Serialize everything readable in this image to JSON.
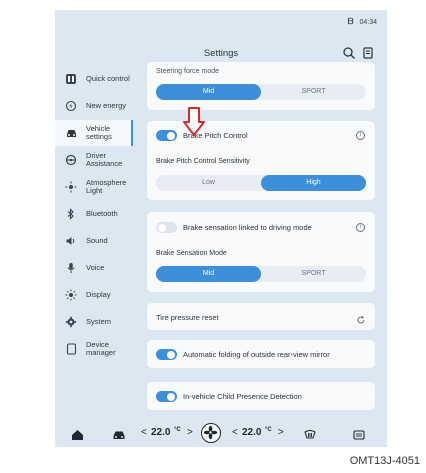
{
  "status": {
    "clock": "04:34",
    "icon": "b-icon"
  },
  "header": {
    "title": "Settings",
    "search_icon": "search-icon",
    "edit_icon": "edit-icon"
  },
  "sidebar": {
    "items": [
      {
        "label": "Quick control",
        "icon": "quick-control-icon"
      },
      {
        "label": "New energy",
        "icon": "new-energy-icon"
      },
      {
        "label": "Vehicle settings",
        "icon": "car-icon",
        "active": true
      },
      {
        "label": "Driver Assistance",
        "icon": "steering-wheel-icon"
      },
      {
        "label": "Atmosphere Light",
        "icon": "atmosphere-light-icon"
      },
      {
        "label": "Bluetooth",
        "icon": "bluetooth-icon"
      },
      {
        "label": "Sound",
        "icon": "speaker-icon"
      },
      {
        "label": "Voice",
        "icon": "microphone-icon"
      },
      {
        "label": "Display",
        "icon": "sun-icon"
      },
      {
        "label": "System",
        "icon": "gear-icon"
      },
      {
        "label": "Device manager",
        "icon": "tablet-icon"
      }
    ]
  },
  "main": {
    "steering": {
      "label": "Steering force mode",
      "options": [
        "Mid",
        "SPORT"
      ],
      "selected": "Mid"
    },
    "brake_pitch": {
      "label": "Brake Pitch Control",
      "enabled": true,
      "info_icon": "info-icon"
    },
    "brake_pitch_sensitivity": {
      "label": "Brake Pitch Control Sensitivity",
      "options": [
        "Low",
        "High"
      ],
      "selected": "High"
    },
    "brake_sensation_link": {
      "label": "Brake sensation linked to driving mode",
      "enabled": false,
      "info_icon": "info-icon"
    },
    "brake_sensation_mode": {
      "label": "Brake Sensation Mode",
      "options": [
        "Mid",
        "SPORT"
      ],
      "selected": "Mid"
    },
    "tire_pressure": {
      "label": "Tire pressure reset",
      "icon": "reset-icon"
    },
    "mirror_folding": {
      "label": "Automatic folding of outside rear-view mirror",
      "enabled": true
    },
    "child_presence": {
      "label": "In-vehicle Child Presence Detection",
      "enabled": true
    }
  },
  "bottombar": {
    "left_temp": "22.0",
    "right_temp": "22.0",
    "temp_unit": "°C",
    "chev_left": "<",
    "chev_right": ">"
  },
  "caption": "OMT13J-4051",
  "colors": {
    "accent": "#3d8fd9",
    "background": "#dde7f1",
    "card": "#f8fafc"
  }
}
